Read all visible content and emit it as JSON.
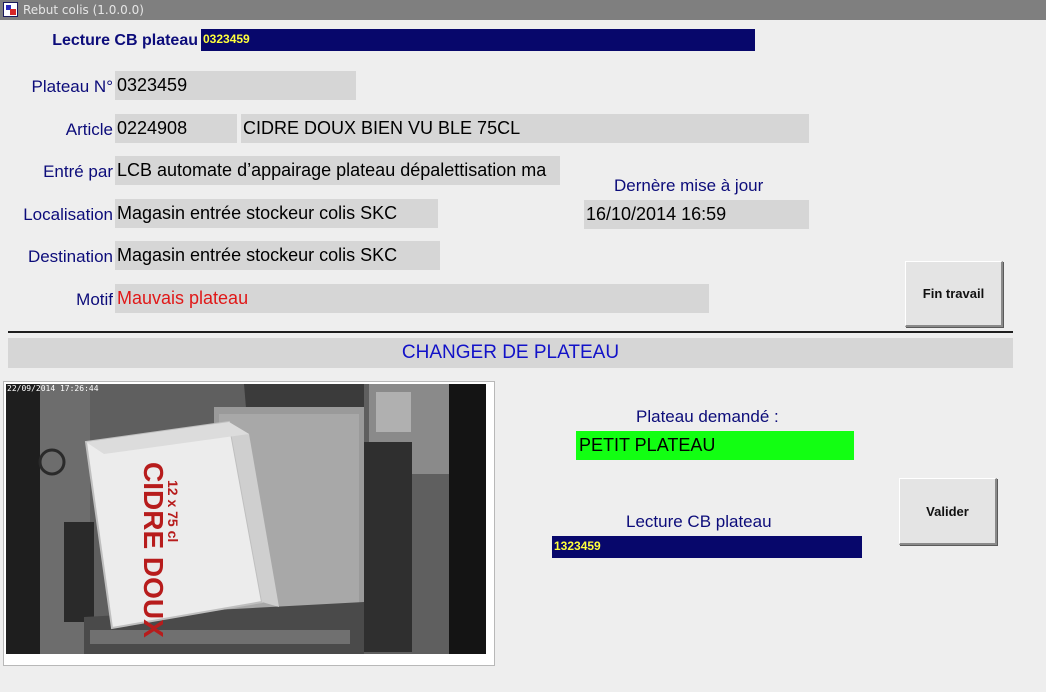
{
  "window": {
    "title": "Rebut colis (1.0.0.0)"
  },
  "header": {
    "scan_label": "Lecture CB plateau",
    "scan_value": "0323459"
  },
  "info": {
    "plateau_label": "Plateau N°",
    "plateau_value": "0323459",
    "article_label": "Article",
    "article_code": "0224908",
    "article_desc": "CIDRE DOUX BIEN VU BLE 75CL",
    "entre_label": "Entré par",
    "entre_value": "LCB automate d’appairage plateau dépalettisation ma",
    "localisation_label": "Localisation",
    "localisation_value": "Magasin entrée stockeur colis SKC",
    "destination_label": "Destination",
    "destination_value": "Magasin entrée stockeur colis SKC",
    "motif_label": "Motif",
    "motif_value": "Mauvais plateau",
    "maj_label": "Dernère mise à jour",
    "maj_value": "16/10/2014 16:59"
  },
  "buttons": {
    "fin_travail": "Fin travail",
    "valider": "Valider"
  },
  "section": {
    "title": "CHANGER DE PLATEAU"
  },
  "camera": {
    "timestamp": "22/09/2014 17:26:44",
    "box_brand": "CIDRE DOUX",
    "box_format": "12 x 75 cl"
  },
  "change": {
    "demande_label": "Plateau demandé :",
    "demande_value": "PETIT PLATEAU",
    "scan_label": "Lecture CB plateau",
    "scan_value": "1323459"
  },
  "colors": {
    "label": "#0c0c7a",
    "field_bg": "#d6d6d6",
    "scan_bg": "#07076b",
    "scan_text": "#ffff3c",
    "motif": "#e01818",
    "section_title": "#1212c8",
    "green_field": "#12ff12"
  }
}
